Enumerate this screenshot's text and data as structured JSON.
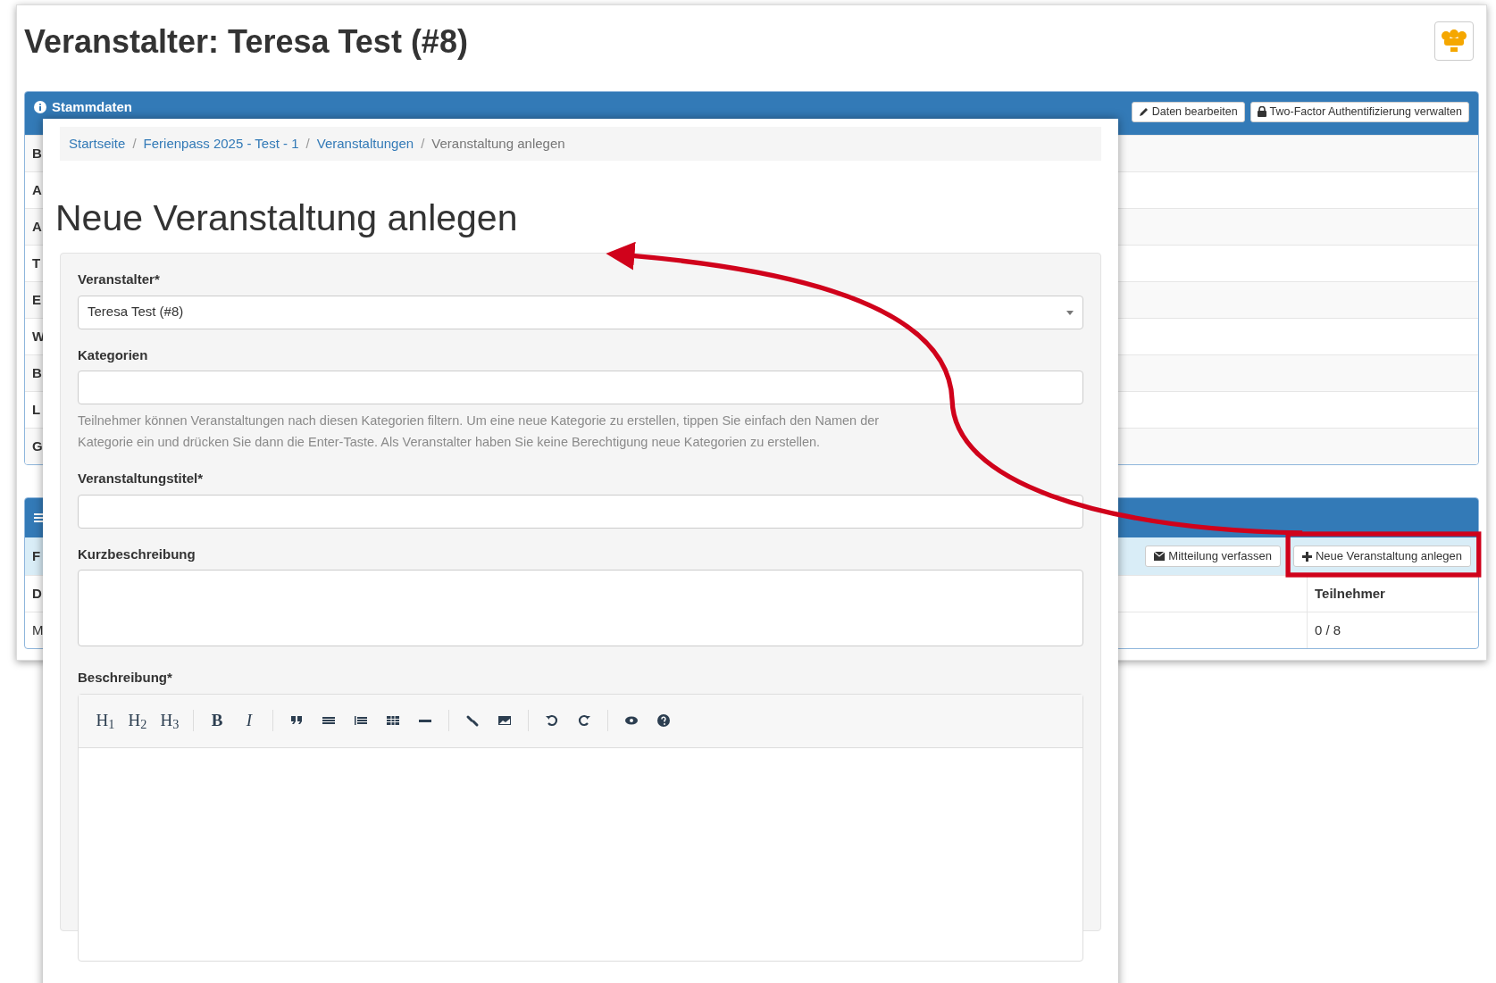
{
  "organizer_window": {
    "title": "Veranstalter: Teresa Test (#8)",
    "stammdaten": {
      "title": "Stammdaten",
      "buttons": [
        "Daten bearbeiten",
        "Two-Factor Authentifizierung verwalten"
      ],
      "rows": [
        "B",
        "A",
        "A",
        "T",
        "E",
        "W",
        "B",
        "L",
        "G"
      ]
    },
    "events": {
      "toolbar_label": "F",
      "buttons": [
        "Mitteilung verfassen",
        "Neue Veranstaltung anlegen"
      ],
      "columns": [
        "D",
        "Teilnehmer"
      ],
      "rows": [
        [
          "M",
          "0 / 8"
        ]
      ]
    }
  },
  "form_window": {
    "breadcrumb_separator": "/",
    "breadcrumb": [
      {
        "label": "Startseite",
        "current": false
      },
      {
        "label": "Ferienpass 2025 - Test - 1",
        "current": false
      },
      {
        "label": "Veranstaltungen",
        "current": false
      },
      {
        "label": "Veranstaltung anlegen",
        "current": true
      }
    ],
    "heading": "Neue Veranstaltung anlegen",
    "fields": [
      {
        "kind": "select",
        "label": "Veranstalter*",
        "value": "Teresa Test (#8)"
      },
      {
        "kind": "text",
        "label": "Kategorien",
        "help": "Teilnehmer können Veranstaltungen nach diesen Kategorien filtern. Um eine neue Kategorie zu erstellen, tippen Sie einfach den Namen der Kategorie ein und drücken Sie dann die Enter-Taste. Als Veranstalter haben Sie keine Berechtigung neue Kategorien zu erstellen."
      },
      {
        "kind": "text",
        "label": "Veranstaltungstitel*"
      },
      {
        "kind": "textarea",
        "label": "Kurzbeschreibung"
      },
      {
        "kind": "editor",
        "label": "Beschreibung*",
        "toolbar_text": [
          "H$_{1}$",
          "H$_{2}$",
          "H$_{3}$",
          "B",
          "I"
        ]
      }
    ]
  }
}
